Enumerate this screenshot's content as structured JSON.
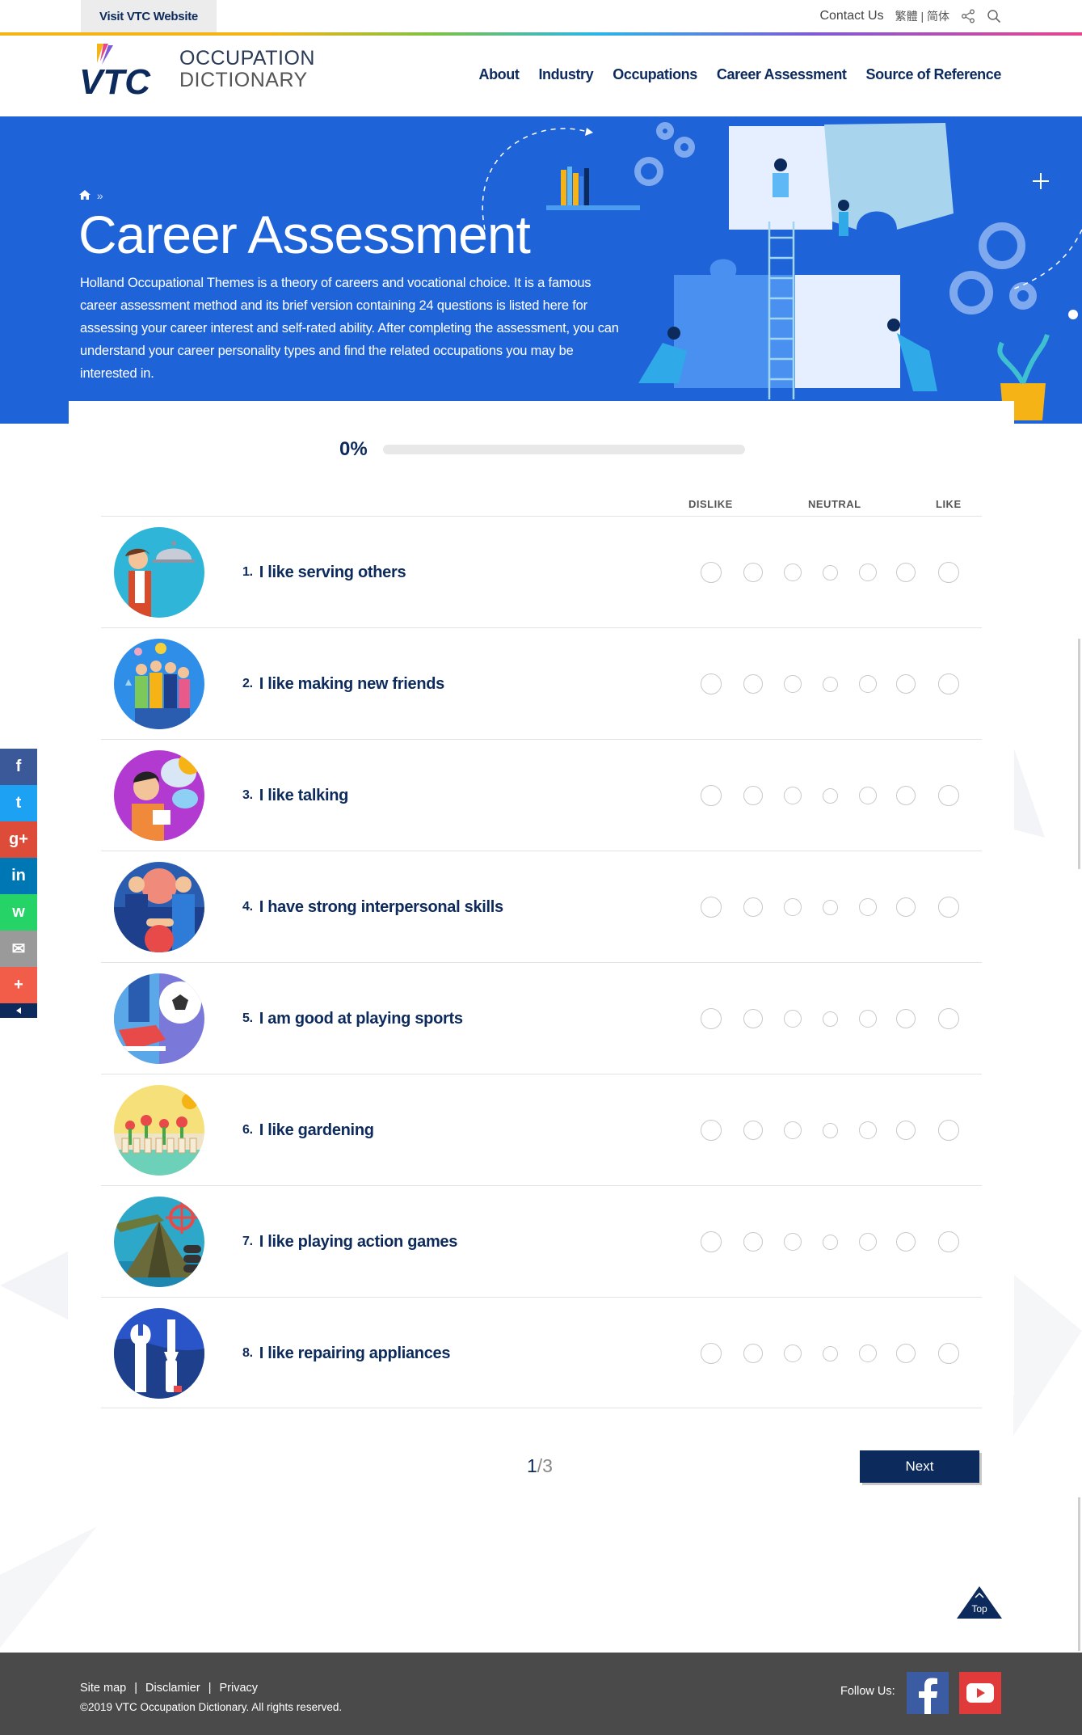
{
  "topbar": {
    "visit_label": "Visit VTC Website",
    "contact_label": "Contact Us",
    "lang_trad": "繁體",
    "lang_sep": "|",
    "lang_simp": "简体"
  },
  "logo": {
    "brand": "VTC",
    "line1": "OCCUPATION",
    "line2": "DICTIONARY"
  },
  "nav": [
    "About",
    "Industry",
    "Occupations",
    "Career Assessment",
    "Source of Reference"
  ],
  "hero": {
    "breadcrumb_sep": "»",
    "title": "Career Assessment",
    "description": "Holland Occupational Themes is a theory of careers and vocational choice. It is a famous career assessment method and its brief version containing 24 questions is listed here for assessing your career interest and self-rated ability. After completing the assessment, you can understand your career personality types and find the related occupations you may be interested in."
  },
  "progress": {
    "label": "0%",
    "value": 0
  },
  "scale": {
    "dislike": "DISLIKE",
    "neutral": "NEUTRAL",
    "like": "LIKE"
  },
  "questions": [
    {
      "num": "1.",
      "text": "I like serving others",
      "image": "waiter-illustration"
    },
    {
      "num": "2.",
      "text": "I like making new friends",
      "image": "friends-group-illustration"
    },
    {
      "num": "3.",
      "text": "I like talking",
      "image": "talking-person-illustration"
    },
    {
      "num": "4.",
      "text": "I have strong interpersonal skills",
      "image": "handshake-illustration"
    },
    {
      "num": "5.",
      "text": "I am good at playing sports",
      "image": "football-illustration"
    },
    {
      "num": "6.",
      "text": "I like gardening",
      "image": "garden-flowers-illustration"
    },
    {
      "num": "7.",
      "text": "I like playing action games",
      "image": "action-game-illustration"
    },
    {
      "num": "8.",
      "text": "I like repairing appliances",
      "image": "wrench-screwdriver-illustration"
    }
  ],
  "pager": {
    "current": "1",
    "total": "/3"
  },
  "next_label": "Next",
  "top_label": "Top",
  "share_items": [
    {
      "name": "facebook",
      "glyph": "f",
      "color": "#3b5998"
    },
    {
      "name": "twitter",
      "glyph": "t",
      "color": "#1da1f2"
    },
    {
      "name": "google-plus",
      "glyph": "g+",
      "color": "#dd4b39"
    },
    {
      "name": "linkedin",
      "glyph": "in",
      "color": "#0077b5"
    },
    {
      "name": "whatsapp",
      "glyph": "w",
      "color": "#25d366"
    },
    {
      "name": "email",
      "glyph": "✉",
      "color": "#9a9a9a"
    },
    {
      "name": "more",
      "glyph": "+",
      "color": "#f25d4a"
    }
  ],
  "footer": {
    "links": [
      "Site map",
      "Disclamier",
      "Privacy"
    ],
    "copyright": "©2019 VTC Occupation Dictionary. All rights reserved.",
    "follow_label": "Follow Us:"
  }
}
